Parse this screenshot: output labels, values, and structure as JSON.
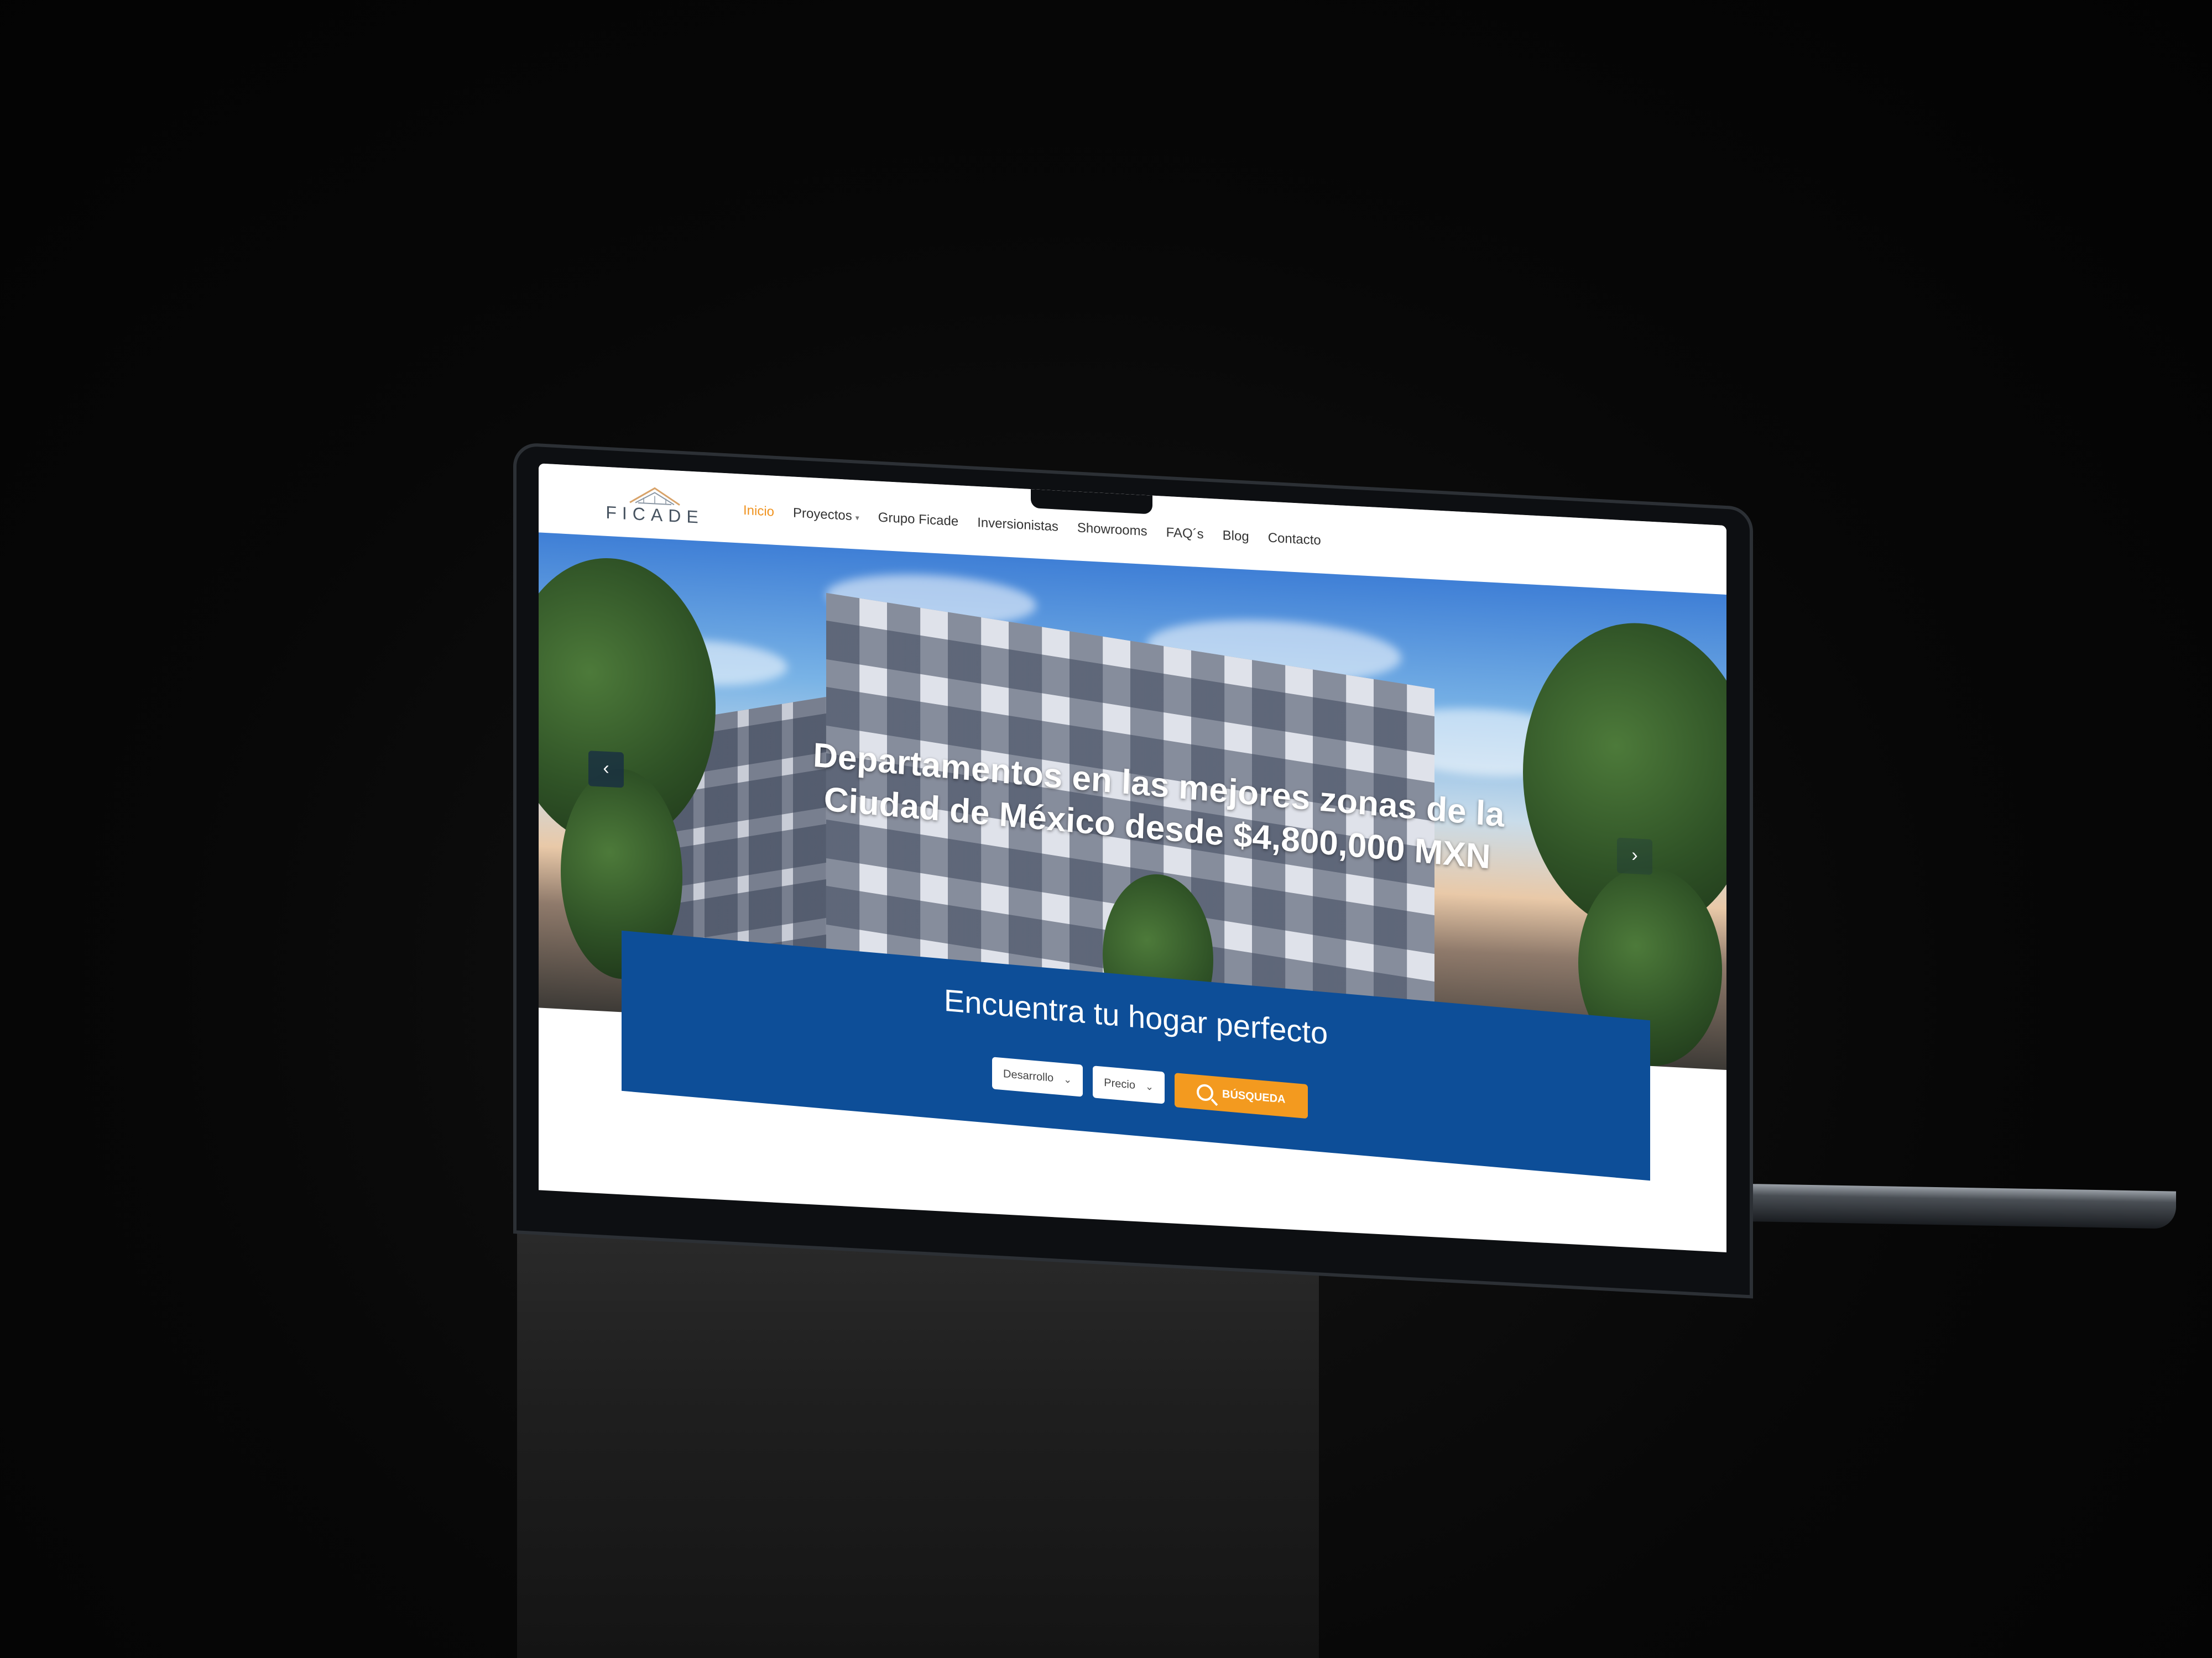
{
  "site": {
    "logo_text": "FICADE",
    "nav": [
      {
        "label": "Inicio",
        "active": true
      },
      {
        "label": "Proyectos",
        "has_dropdown": true
      },
      {
        "label": "Grupo Ficade"
      },
      {
        "label": "Inversionistas"
      },
      {
        "label": "Showrooms"
      },
      {
        "label": "FAQ´s"
      },
      {
        "label": "Blog"
      },
      {
        "label": "Contacto"
      }
    ]
  },
  "hero": {
    "title": "Departamentos en las mejores zonas de la Ciudad de México desde $4,800,000 MXN",
    "prev_icon": "chevron-left-icon",
    "next_icon": "chevron-right-icon"
  },
  "search": {
    "heading": "Encuentra tu hogar perfecto",
    "development_select": "Desarrollo",
    "price_select": "Precio",
    "button_label": "BÚSQUEDA",
    "button_icon": "search-icon"
  },
  "colors": {
    "accent": "#f39a1f",
    "brand_blue": "#0d4e98",
    "nav_active": "#f0931f"
  }
}
